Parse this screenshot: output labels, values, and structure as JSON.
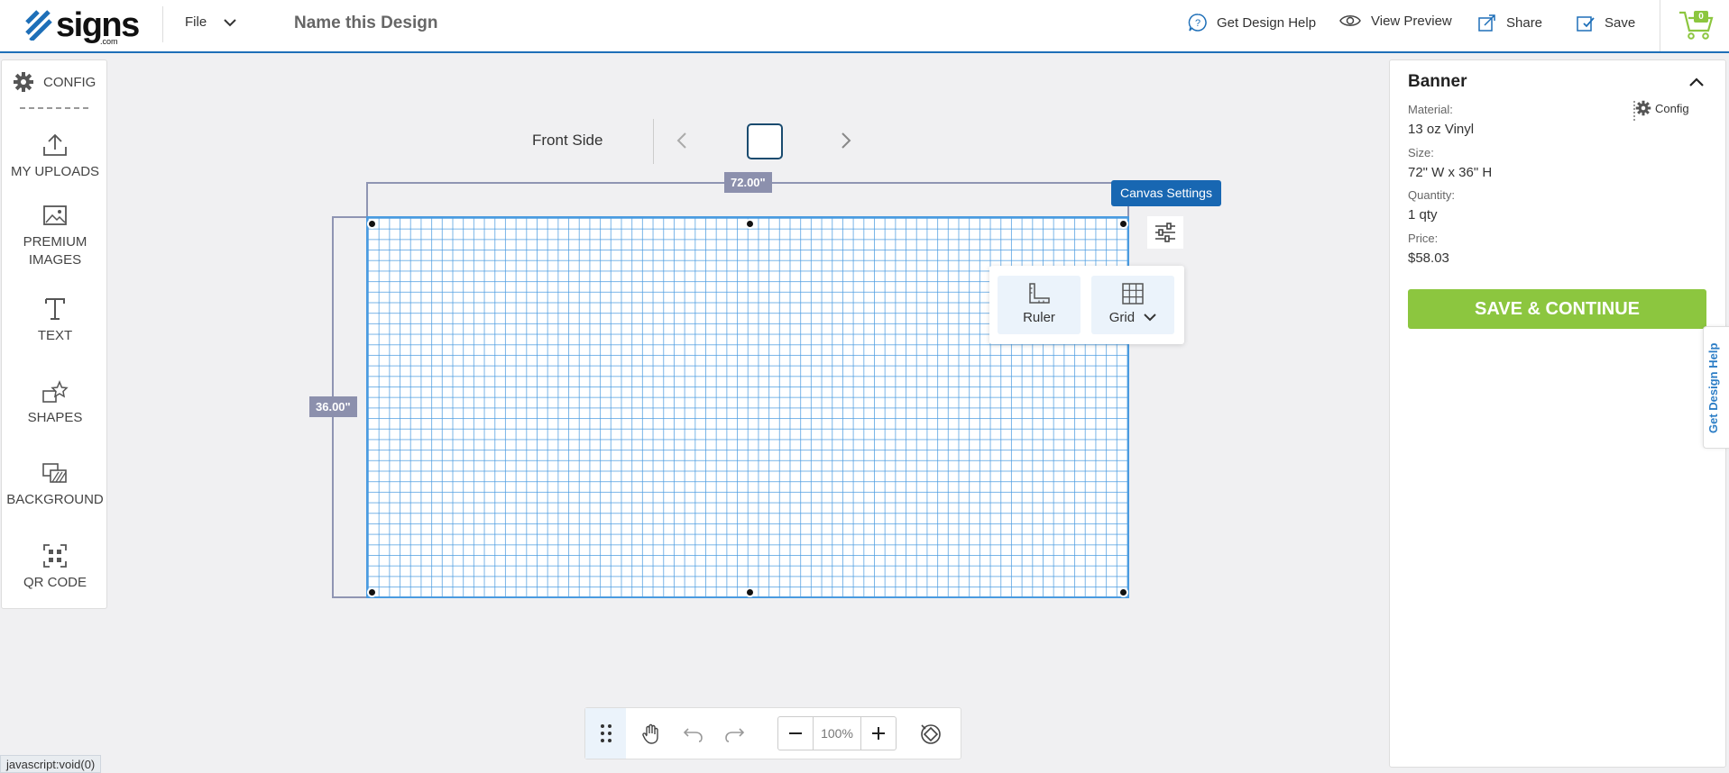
{
  "header": {
    "brand": "signs",
    "brand_suffix": ".com",
    "file_menu": "File",
    "design_name": "Name this Design",
    "actions": {
      "help": "Get Design Help",
      "preview": "View Preview",
      "share": "Share",
      "save": "Save"
    },
    "cart_count": "0"
  },
  "sidebar": {
    "config": "CONFIG",
    "items": [
      {
        "label": "MY UPLOADS"
      },
      {
        "label": "PREMIUM IMAGES"
      },
      {
        "label": "TEXT"
      },
      {
        "label": "SHAPES"
      },
      {
        "label": "BACKGROUND"
      },
      {
        "label": "QR CODE"
      }
    ]
  },
  "canvas": {
    "side_label": "Front Side",
    "width_label": "72.00\"",
    "height_label": "36.00\"",
    "settings_button": "Canvas Settings",
    "options": {
      "ruler": "Ruler",
      "grid": "Grid"
    }
  },
  "toolbar": {
    "zoom": "100%"
  },
  "product": {
    "title": "Banner",
    "config": "Config",
    "material_label": "Material:",
    "material": "13 oz Vinyl",
    "size_label": "Size:",
    "size": "72\" W x 36\" H",
    "quantity_label": "Quantity:",
    "quantity": "1 qty",
    "price_label": "Price:",
    "price": "$58.03",
    "save_continue": "SAVE & CONTINUE"
  },
  "help_tab": "Get Design Help",
  "status_bar": "javascript:void(0)",
  "colors": {
    "accent": "#1867b2",
    "brand_green": "#8cc63f",
    "grid": "#4a9be0",
    "dimension": "#8c90ad"
  }
}
